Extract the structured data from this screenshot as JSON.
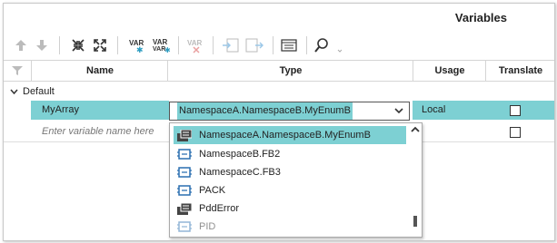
{
  "panel": {
    "title": "Variables"
  },
  "toolbar": {
    "icons": [
      "move-up-icon",
      "move-down-icon",
      "collapse-all-icon",
      "expand-all-icon",
      "add-variable-icon",
      "add-variable-below-icon",
      "delete-variable-icon",
      "export-icon",
      "import-icon",
      "table-view-icon",
      "search-icon"
    ],
    "var_label": "VAR"
  },
  "columns": {
    "name": "Name",
    "type": "Type",
    "usage": "Usage",
    "translate": "Translate"
  },
  "group": {
    "label": "Default"
  },
  "rows": [
    {
      "name": "MyArray",
      "type": "NamespaceA.NamespaceB.MyEnumB",
      "usage": "Local",
      "translate": false
    },
    {
      "name_placeholder": "Enter variable name here",
      "translate": false
    }
  ],
  "dropdown": {
    "items": [
      {
        "label": "NamespaceA.NamespaceB.MyEnumB",
        "icon": "enum-icon",
        "selected": true
      },
      {
        "label": "NamespaceB.FB2",
        "icon": "function-block-icon"
      },
      {
        "label": "NamespaceC.FB3",
        "icon": "function-block-icon"
      },
      {
        "label": "PACK",
        "icon": "function-block-icon"
      },
      {
        "label": "PddError",
        "icon": "enum-icon"
      },
      {
        "label": "PID",
        "icon": "function-block-icon",
        "faded": true
      }
    ]
  },
  "colors": {
    "accent": "#7dd0d3",
    "icon_blue": "#2a6fb0"
  }
}
